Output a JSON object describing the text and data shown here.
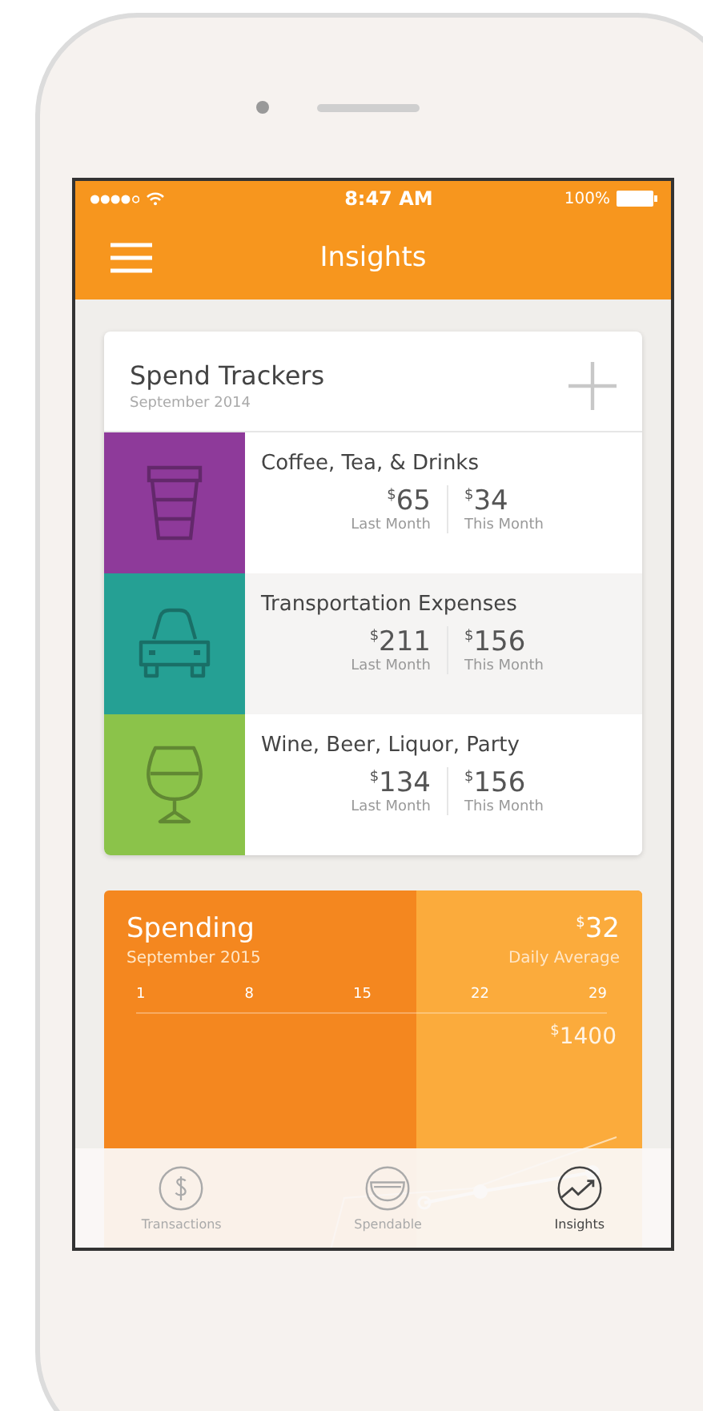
{
  "status_bar": {
    "time": "8:47 AM",
    "battery": "100%"
  },
  "header": {
    "title": "Insights"
  },
  "spend_trackers": {
    "title": "Spend Trackers",
    "subtitle": "September 2014",
    "trackers": [
      {
        "kind": "cup",
        "color": "#8e3a9a",
        "name": "Coffee, Tea, & Drinks",
        "last_month": {
          "currency": "$",
          "amount": "65",
          "label": "Last Month"
        },
        "this_month": {
          "currency": "$",
          "amount": "34",
          "label": "This Month"
        }
      },
      {
        "kind": "car",
        "color": "#25a094",
        "name": "Transportation Expenses",
        "last_month": {
          "currency": "$",
          "amount": "211",
          "label": "Last Month"
        },
        "this_month": {
          "currency": "$",
          "amount": "156",
          "label": "This Month"
        }
      },
      {
        "kind": "glass",
        "color": "#8bc34a",
        "name": "Wine, Beer, Liquor, Party",
        "last_month": {
          "currency": "$",
          "amount": "134",
          "label": "Last Month"
        },
        "this_month": {
          "currency": "$",
          "amount": "156",
          "label": "This Month"
        }
      }
    ]
  },
  "spending": {
    "title": "Spending",
    "subtitle": "September 2015",
    "average": {
      "currency": "$",
      "amount": "32",
      "label": "Daily Average"
    },
    "day_ticks": [
      "1",
      "8",
      "15",
      "22",
      "29"
    ],
    "total": {
      "currency": "$",
      "amount": "1400"
    }
  },
  "tab_bar": [
    {
      "kind": "dollar",
      "label": "Transactions",
      "selected": false
    },
    {
      "kind": "bowl",
      "label": "Spendable",
      "selected": false
    },
    {
      "kind": "trend",
      "label": "Insights",
      "selected": true
    }
  ]
}
